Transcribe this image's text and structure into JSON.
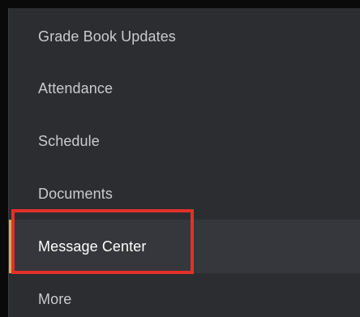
{
  "nav": {
    "items": [
      {
        "label": "Grade Book Updates",
        "active": false
      },
      {
        "label": "Attendance",
        "active": false
      },
      {
        "label": "Schedule",
        "active": false
      },
      {
        "label": "Documents",
        "active": false
      },
      {
        "label": "Message Center",
        "active": true
      },
      {
        "label": "More",
        "active": false
      }
    ]
  },
  "colors": {
    "background": "#2b2d31",
    "active_background": "#35373c",
    "text": "#c9cbce",
    "active_text": "#ffffff",
    "highlight": "#e2312b",
    "active_indicator": "#e0a85a"
  }
}
